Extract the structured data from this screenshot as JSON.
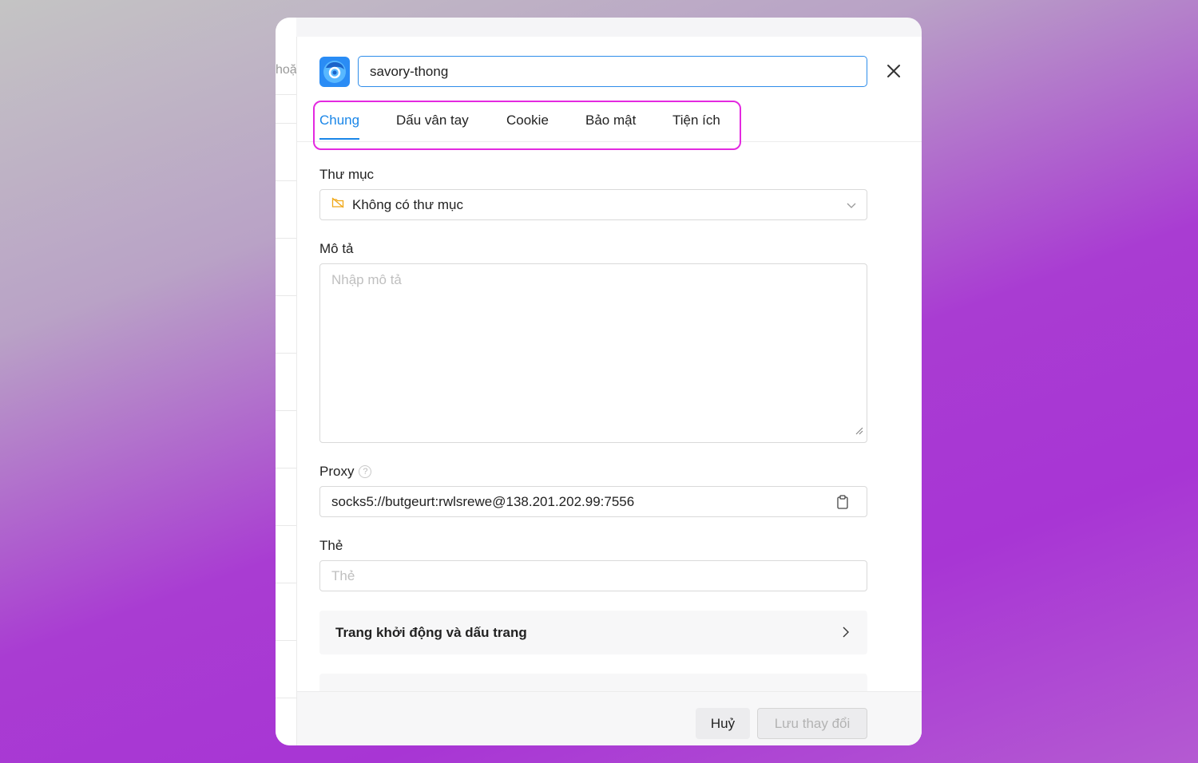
{
  "background_app": {
    "search_fragment": "hoặ"
  },
  "header": {
    "profile_name": "savory-thong"
  },
  "tabs": [
    {
      "label": "Chung",
      "active": true
    },
    {
      "label": "Dấu vân tay",
      "active": false
    },
    {
      "label": "Cookie",
      "active": false
    },
    {
      "label": "Bảo mật",
      "active": false
    },
    {
      "label": "Tiện ích",
      "active": false
    }
  ],
  "folder": {
    "label": "Thư mục",
    "value": "Không có thư mục"
  },
  "description": {
    "label": "Mô tả",
    "placeholder": "Nhập mô tả"
  },
  "proxy": {
    "label": "Proxy",
    "value": "socks5://butgeurt:rwlsrewe@138.201.202.99:7556"
  },
  "tags": {
    "label": "Thẻ",
    "placeholder": "Thẻ"
  },
  "sections": {
    "startup": "Trang khởi động và dấu trang"
  },
  "footer": {
    "cancel": "Huỷ",
    "save": "Lưu thay đổi"
  },
  "colors": {
    "accent": "#1a86e8",
    "highlight": "#e329e0",
    "folder_icon": "#f0a818"
  }
}
